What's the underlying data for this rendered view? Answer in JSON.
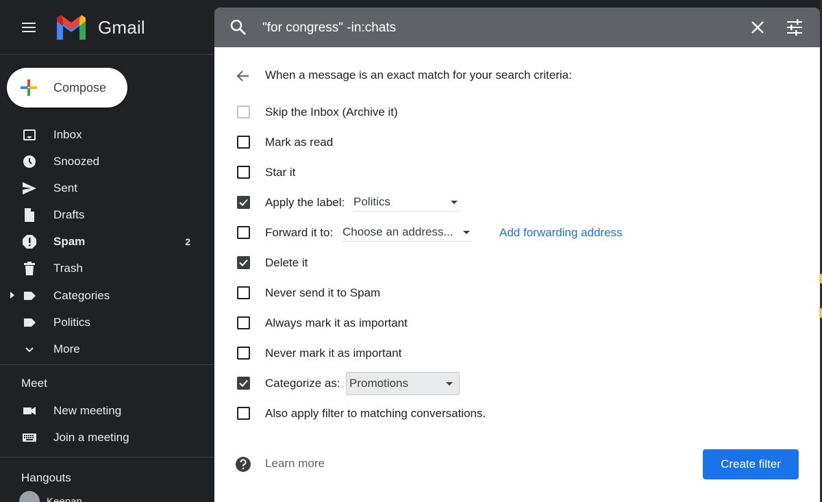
{
  "app": {
    "name": "Gmail"
  },
  "compose": {
    "label": "Compose"
  },
  "sidebar": {
    "items": [
      {
        "label": "Inbox",
        "icon": "inbox-icon"
      },
      {
        "label": "Snoozed",
        "icon": "clock-icon"
      },
      {
        "label": "Sent",
        "icon": "send-icon"
      },
      {
        "label": "Drafts",
        "icon": "draft-icon"
      },
      {
        "label": "Spam",
        "icon": "spam-icon",
        "count": "2",
        "bold": true
      },
      {
        "label": "Trash",
        "icon": "trash-icon"
      },
      {
        "label": "Categories",
        "icon": "label-icon",
        "expandable": true
      },
      {
        "label": "Politics",
        "icon": "label-icon"
      },
      {
        "label": "More",
        "icon": "chevron-down-icon"
      }
    ]
  },
  "meet": {
    "title": "Meet",
    "items": [
      {
        "label": "New meeting",
        "icon": "video-icon"
      },
      {
        "label": "Join a meeting",
        "icon": "keyboard-icon"
      }
    ]
  },
  "hangouts": {
    "title": "Hangouts",
    "user_name": "Keenan"
  },
  "search": {
    "query": "\"for congress\" -in:chats"
  },
  "filter": {
    "title": "When a message is an exact match for your search criteria:",
    "options": {
      "skip_inbox": {
        "label": "Skip the Inbox (Archive it)",
        "checked": false,
        "disabled": true
      },
      "mark_read": {
        "label": "Mark as read",
        "checked": false
      },
      "star": {
        "label": "Star it",
        "checked": false
      },
      "apply_label": {
        "label": "Apply the label:",
        "checked": true,
        "value": "Politics"
      },
      "forward": {
        "label": "Forward it to:",
        "checked": false,
        "value": "Choose an address...",
        "link": "Add forwarding address"
      },
      "delete": {
        "label": "Delete it",
        "checked": true
      },
      "never_spam": {
        "label": "Never send it to Spam",
        "checked": false
      },
      "always_important": {
        "label": "Always mark it as important",
        "checked": false
      },
      "never_important": {
        "label": "Never mark it as important",
        "checked": false
      },
      "categorize": {
        "label": "Categorize as:",
        "checked": true,
        "value": "Promotions"
      },
      "also_apply": {
        "label": "Also apply filter to matching conversations.",
        "checked": false
      }
    },
    "learn_more": "Learn more",
    "create_button": "Create filter"
  },
  "colors": {
    "accent": "#1a73e8",
    "sidebar_bg": "#202124",
    "search_bg": "#5f6368"
  }
}
